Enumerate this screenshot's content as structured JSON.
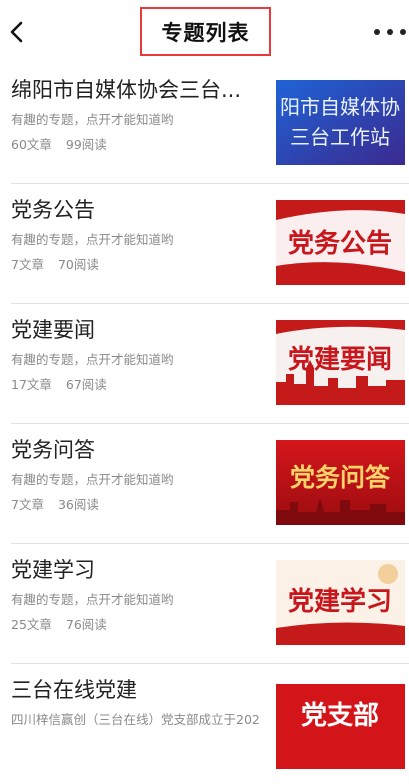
{
  "header": {
    "title": "专题列表",
    "back_icon": "chevron-left-icon",
    "more_icon": "more-horizontal-icon"
  },
  "items": [
    {
      "name": "绵阳市自媒体协会三台...",
      "desc": "有趣的专题，点开才能知道哟",
      "articles": "60文章",
      "reads": "99阅读",
      "thumb_text": [
        "阳市自媒体协",
        "三台工作站"
      ],
      "thumb_style": "blue"
    },
    {
      "name": "党务公告",
      "desc": "有趣的专题，点开才能知道哟",
      "articles": "7文章",
      "reads": "70阅读",
      "thumb_text": [
        "党务公告"
      ],
      "thumb_style": "red-light"
    },
    {
      "name": "党建要闻",
      "desc": "有趣的专题，点开才能知道哟",
      "articles": "17文章",
      "reads": "67阅读",
      "thumb_text": [
        "党建要闻"
      ],
      "thumb_style": "red-light"
    },
    {
      "name": "党务问答",
      "desc": "有趣的专题，点开才能知道哟",
      "articles": "7文章",
      "reads": "36阅读",
      "thumb_text": [
        "党务问答"
      ],
      "thumb_style": "red-dark"
    },
    {
      "name": "党建学习",
      "desc": "有趣的专题，点开才能知道哟",
      "articles": "25文章",
      "reads": "76阅读",
      "thumb_text": [
        "党建学习"
      ],
      "thumb_style": "red-light"
    },
    {
      "name": "三台在线党建",
      "desc": "四川梓信赢创（三台在线）党支部成立于202",
      "articles": "",
      "reads": "",
      "thumb_text": [
        "党支部"
      ],
      "thumb_style": "red-dark"
    }
  ],
  "colors": {
    "highlight_border": "#e8393b",
    "title_text": "#111111",
    "secondary_text": "#8a8a8a",
    "divider": "#e2e2e2"
  }
}
